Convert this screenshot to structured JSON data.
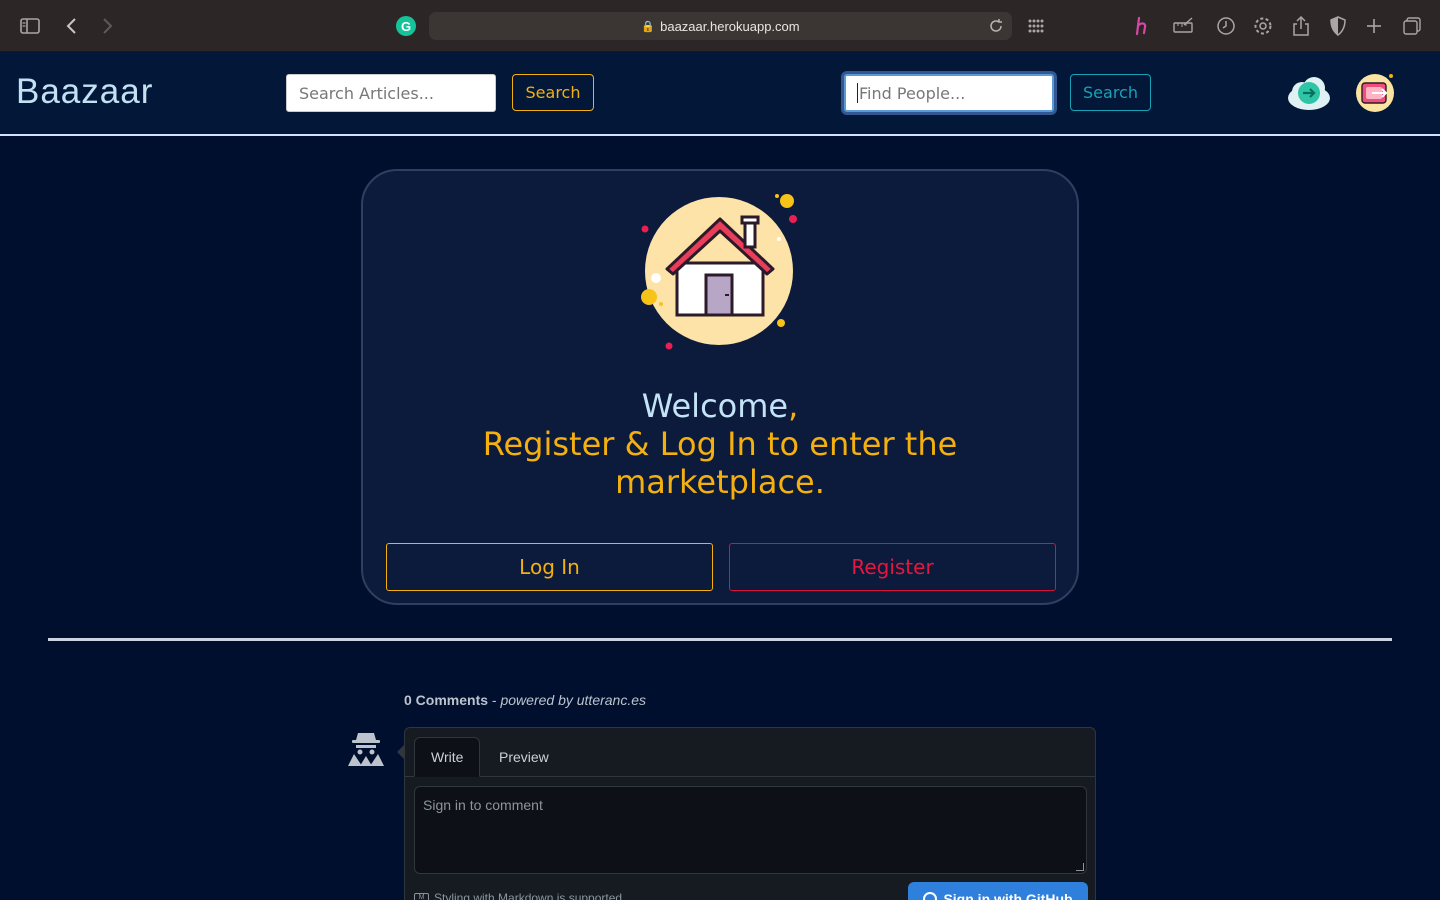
{
  "browser": {
    "url": "baazaar.herokuapp.com",
    "icons": [
      "sidebar-icon",
      "back-icon",
      "forward-icon",
      "grammarly-icon",
      "lock-icon",
      "reload-icon",
      "grid-icon",
      "honey-icon",
      "ruler-icon",
      "history-icon",
      "gear-icon",
      "share-icon",
      "shield-icon",
      "new-tab-icon",
      "tabs-icon"
    ],
    "grammarly_letter": "G"
  },
  "header": {
    "brand": "Baazaar",
    "articles_search": {
      "placeholder": "Search Articles...",
      "button": "Search",
      "accent": "#f3b00f"
    },
    "people_search": {
      "placeholder": "Find People...",
      "button": "Search",
      "accent": "#17a2b8"
    },
    "icons": [
      "cloud-login-icon",
      "logout-icon"
    ]
  },
  "card": {
    "illustration": "house-icon",
    "welcome": "Welcome",
    "welcome_comma": ",",
    "tagline_line1": "Register & Log In to enter the",
    "tagline_line2": "marketplace.",
    "login_button": "Log In",
    "register_button": "Register",
    "colors": {
      "welcome": "#c5e3f6",
      "gold": "#f3b00f",
      "red": "#e5173f"
    }
  },
  "comments": {
    "count_label": "0 Comments",
    "separator": " - ",
    "powered_by": "powered by utteranc.es",
    "tabs": [
      "Write",
      "Preview"
    ],
    "textarea_placeholder": "Sign in to comment",
    "markdown_note": "Styling with Markdown is supported",
    "markdown_badge": "M",
    "signin_button": "Sign in with GitHub"
  }
}
